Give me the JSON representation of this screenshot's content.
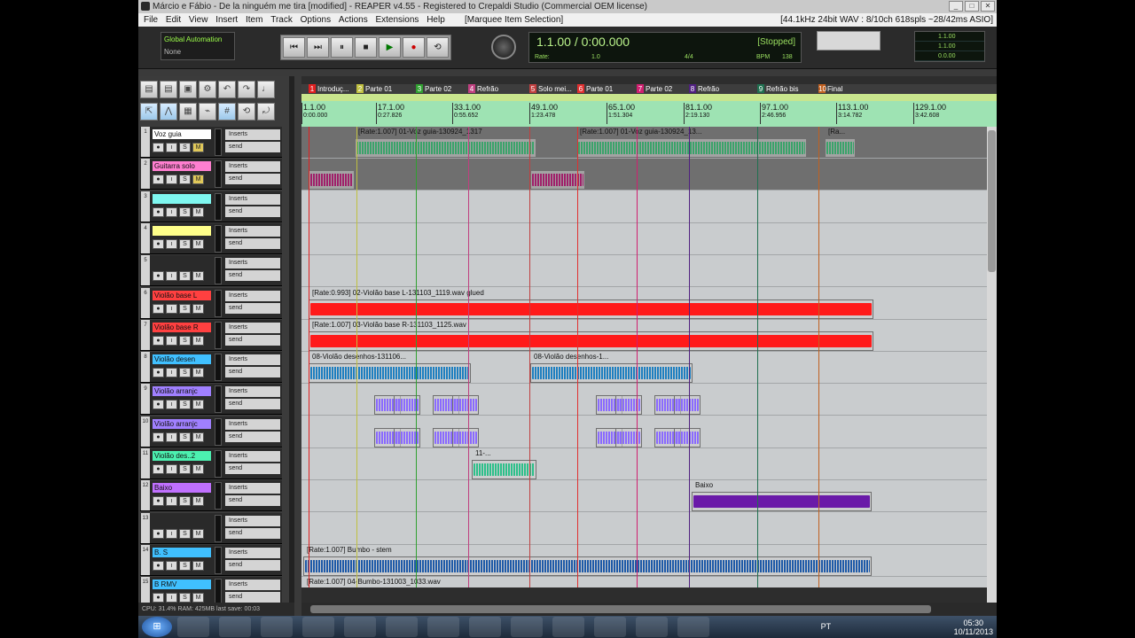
{
  "window": {
    "title": "Márcio e Fábio - De la ninguém me tira [modified] - REAPER v4.55 - Registered to Crepaldi Studio (Commercial OEM license)",
    "buttons": [
      "_",
      "□",
      "✕"
    ]
  },
  "menu": {
    "items": [
      "File",
      "Edit",
      "View",
      "Insert",
      "Item",
      "Track",
      "Options",
      "Actions",
      "Extensions",
      "Help"
    ],
    "status": "[Marquee Item Selection]",
    "right": "[44.1kHz 24bit WAV : 8/10ch 618spls ~28/42ms ASIO]"
  },
  "transport": {
    "global_automation_label": "Global Automation",
    "global_automation_value": "None",
    "buttons": [
      "⏮",
      "⏭",
      "⏸",
      "■",
      "▶",
      "●",
      "⟲"
    ],
    "position": "1.1.00 / 0:00.000",
    "state": "[Stopped]",
    "rate_label": "Rate:",
    "rate_value": "1.0",
    "time_sig": "4/4",
    "bpm_label": "BPM",
    "bpm_value": "138",
    "right_display": [
      "1.1.00",
      "1.1.00",
      "0.0.00"
    ]
  },
  "toolbar_icons": [
    "grid-icon",
    "save-icon",
    "disk-icon",
    "gear-icon",
    "undo-icon",
    "redo-icon",
    "metronome-icon",
    "ripple-icon",
    "envelope-icon",
    "grid2-icon",
    "snap-icon",
    "grid3-icon",
    "loop-icon",
    "lock-icon"
  ],
  "toolbar_glyphs": [
    "▤",
    "▤",
    "▣",
    "⚙",
    "↶",
    "↷",
    "♩",
    "⇱",
    "⋀",
    "▦",
    "⌁",
    "#",
    "⟲",
    "⤾"
  ],
  "track_buttons": [
    "●",
    "ı",
    "S",
    "M"
  ],
  "track_controls": {
    "inserts": "Inserts",
    "send": "send"
  },
  "tracks": [
    {
      "num": "1",
      "name": "Voz guia",
      "color": "#ffffff"
    },
    {
      "num": "2",
      "name": "Guitarra solo",
      "color": "#ff7fd0"
    },
    {
      "num": "3",
      "name": "",
      "color": "#7ff7f0"
    },
    {
      "num": "4",
      "name": "",
      "color": "#ffff8a"
    },
    {
      "num": "5",
      "name": "",
      "color": "#2a2a2a"
    },
    {
      "num": "6",
      "name": "Violão base L",
      "color": "#ff4040"
    },
    {
      "num": "7",
      "name": "Violão base R",
      "color": "#ff4040"
    },
    {
      "num": "8",
      "name": "Violão desen",
      "color": "#40c0ff"
    },
    {
      "num": "9",
      "name": "Violão arranjc",
      "color": "#a080ff"
    },
    {
      "num": "10",
      "name": "Violão arranjc",
      "color": "#a080ff"
    },
    {
      "num": "11",
      "name": "Violão des..2",
      "color": "#4cf0b0"
    },
    {
      "num": "12",
      "name": "Baixo",
      "color": "#c070ff"
    },
    {
      "num": "13",
      "name": "",
      "color": "#2a2a2a"
    },
    {
      "num": "14",
      "name": "B. S",
      "color": "#40c0ff"
    },
    {
      "num": "15",
      "name": "B RMV",
      "color": "#40c0ff"
    }
  ],
  "markers": [
    {
      "id": "1",
      "label": "Introduç...",
      "color": "#e02020"
    },
    {
      "id": "2",
      "label": "Parte 01",
      "color": "#c0c040"
    },
    {
      "id": "3",
      "label": "Parte 02",
      "color": "#30a030"
    },
    {
      "id": "4",
      "label": "Refrão",
      "color": "#c04080"
    },
    {
      "id": "5",
      "label": "Solo mei...",
      "color": "#c04040"
    },
    {
      "id": "6",
      "label": "Parte 01",
      "color": "#e03030"
    },
    {
      "id": "7",
      "label": "Parte 02",
      "color": "#d02070"
    },
    {
      "id": "8",
      "label": "Refrão",
      "color": "#502080"
    },
    {
      "id": "9",
      "label": "Refrão bis",
      "color": "#207050"
    },
    {
      "id": "10",
      "label": "Final",
      "color": "#c06020"
    }
  ],
  "ruler": [
    {
      "bar": "1.1.00",
      "time": "0:00.000"
    },
    {
      "bar": "17.1.00",
      "time": "0:27.826"
    },
    {
      "bar": "33.1.00",
      "time": "0:55.652"
    },
    {
      "bar": "49.1.00",
      "time": "1:23.478"
    },
    {
      "bar": "65.1.00",
      "time": "1:51.304"
    },
    {
      "bar": "81.1.00",
      "time": "2:19.130"
    },
    {
      "bar": "97.1.00",
      "time": "2:46.956"
    },
    {
      "bar": "113.1.00",
      "time": "3:14.782"
    },
    {
      "bar": "129.1.00",
      "time": "3:42.608"
    }
  ],
  "items": [
    {
      "track": 0,
      "label": "[Rate:1.007] 01-Voz guia-130924_1317",
      "color": "#3aa36a"
    },
    {
      "track": 0,
      "label": "[Rate:1.007] 01-Voz guia-130924_13...",
      "color": "#3aa36a"
    },
    {
      "track": 0,
      "label": "[Ra...",
      "color": "#3aa36a"
    },
    {
      "track": 1,
      "label": "",
      "color": "#a0206a"
    },
    {
      "track": 1,
      "label": "",
      "color": "#a0206a"
    },
    {
      "track": 5,
      "label": "[Rate:0.993] 02-Violão base L-131103_1119.wav glued",
      "color": "#ff1a1a"
    },
    {
      "track": 6,
      "label": "[Rate:1.007] 03-Violão base R-131103_1125.wav",
      "color": "#ff1a1a"
    },
    {
      "track": 7,
      "label": "08-Violão desenhos-131106...",
      "color": "#1e7fc0"
    },
    {
      "track": 7,
      "label": "08-Violão desenhos-1...",
      "color": "#1e7fc0"
    },
    {
      "track": 10,
      "label": "11-...",
      "color": "#2cc08a"
    },
    {
      "track": 11,
      "label": "Baixo",
      "color": "#6a1aa8"
    },
    {
      "track": 13,
      "label": "[Rate:1.007] Bumbo - stem",
      "color": "#1e5aa8"
    },
    {
      "track": 14,
      "label": "[Rate:1.007] 04-Bumbo-131003_1033.wav",
      "color": "#1e5aa8"
    }
  ],
  "status_line": "CPU: 31.4%   RAM: 425MB   last save: 00:03",
  "taskbar": {
    "start": "⊞",
    "apps": [
      "start-orb",
      "explorer-icon",
      "media-player-icon",
      "app-icon",
      "app-icon",
      "app-icon",
      "app-icon",
      "app-icon",
      "app-icon",
      "app-icon",
      "app-icon",
      "chrome-icon",
      "app-icon",
      "utorrent-icon"
    ],
    "lang": "PT",
    "time": "05:30",
    "date": "10/11/2013"
  }
}
